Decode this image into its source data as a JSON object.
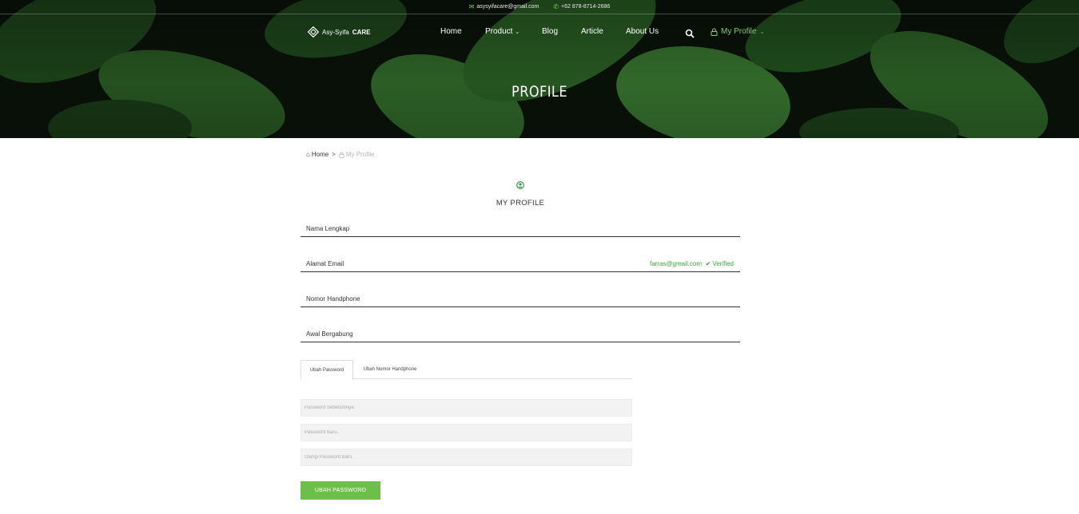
{
  "topbar": {
    "email": "asysyifacare@gmail.com",
    "phone": "+62 878-8714-2686"
  },
  "brand": {
    "name_part1": "Asy-Syifa",
    "name_part2": "CARE"
  },
  "nav": {
    "home": "Home",
    "product": "Product",
    "blog": "Blog",
    "article": "Article",
    "about": "About Us",
    "profile": "My Profile"
  },
  "hero": {
    "title": "PROFILE"
  },
  "breadcrumb": {
    "home": "Home",
    "separator": ">",
    "current": "My Profile"
  },
  "profile": {
    "heading": "MY PROFILE",
    "fields": [
      {
        "label": "Nama Lengkap"
      },
      {
        "label": "Alamat Email",
        "value": "farras@gmail.com",
        "status": "Verified"
      },
      {
        "label": "Nomor Handphone"
      },
      {
        "label": "Awal Bergabung"
      }
    ]
  },
  "tabs": [
    {
      "label": "Ubah Password",
      "active": true
    },
    {
      "label": "Ubah Nomor Handphone",
      "active": false
    }
  ],
  "password_form": {
    "old_placeholder": "Password Sebelumnya.",
    "new_placeholder": "Password Baru.",
    "repeat_placeholder": "Ulangi Password Baru.",
    "submit_label": "UBAH PASSWORD"
  },
  "colors": {
    "accent_green": "#6cc04a",
    "verified_green": "#3aa83a",
    "nav_highlight": "#7fd16a"
  }
}
